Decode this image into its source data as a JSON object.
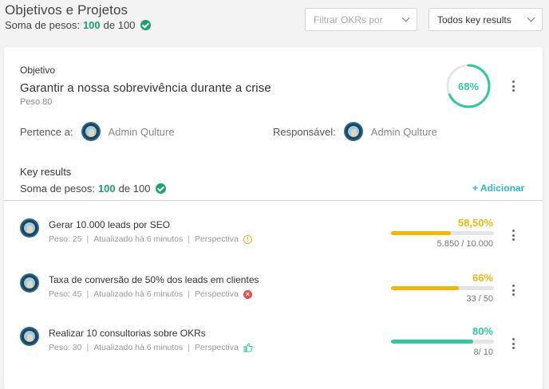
{
  "header": {
    "title": "Objetivos e Projetos",
    "weights_label": "Soma de pesos:",
    "weights_value": "100",
    "weights_of": "de 100"
  },
  "filters": {
    "okr_placeholder": "Filtrar OKRs por",
    "kr_select": "Todos key results"
  },
  "objective": {
    "section_label": "Objetivo",
    "title": "Garantir a nossa sobrevivência durante a crise",
    "weight": "Peso 80",
    "progress_text": "68%",
    "progress": 0.68,
    "belongs_label": "Pertence a:",
    "belongs_name": "Admin Qulture",
    "responsible_label": "Responsável:",
    "responsible_name": "Admin Qulture"
  },
  "key_results": {
    "heading": "Key results",
    "weights_label": "Soma de pesos:",
    "weights_value": "100",
    "weights_of": "de 100",
    "add_label": "+ Adicionar",
    "items": [
      {
        "title": "Gerar 10.000 leads por SEO",
        "weight": "Peso: 25",
        "updated": "Atualizado há 6 minutos",
        "perspective": "Perspectiva",
        "perspective_icon": "warning-icon",
        "pct_text": "58,50%",
        "progress": 0.585,
        "color": "#f2b705",
        "value": "5.850  / 10.000"
      },
      {
        "title": "Taxa de conversão de 50% dos leads em clientes",
        "weight": "Peso: 45",
        "updated": "Atualizado há 6 minutos",
        "perspective": "Perspectiva",
        "perspective_icon": "x-circle-icon",
        "pct_text": "66%",
        "progress": 0.66,
        "color": "#f2b705",
        "value": "33 / 50"
      },
      {
        "title": "Realizar 10 consultorias sobre OKRs",
        "weight": "Peso: 30",
        "updated": "Atualizado há 6 minutos",
        "perspective": "Perspectiva",
        "perspective_icon": "thumbs-up-icon",
        "pct_text": "80%",
        "progress": 0.8,
        "color": "#2ec9a0",
        "value": "8/ 10"
      }
    ]
  },
  "colors": {
    "accent_green": "#1aa36e",
    "ring_teal": "#2ec9a0",
    "link_blue": "#2bb5c9"
  }
}
